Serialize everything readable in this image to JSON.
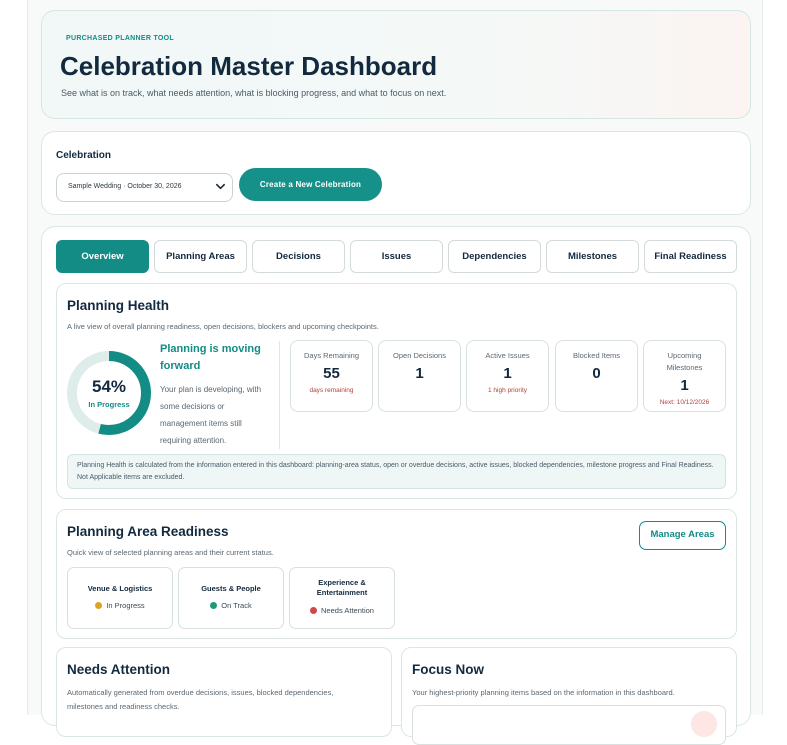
{
  "header": {
    "eyebrow": "PURCHASED PLANNER TOOL",
    "title": "Celebration Master Dashboard",
    "subtitle": "See what is on track, what needs attention, what is blocking progress, and what to focus on next."
  },
  "celebration": {
    "label": "Celebration",
    "selected": "Sample Wedding · October 30, 2026",
    "create_button": "Create a New Celebration"
  },
  "tabs": [
    {
      "label": "Overview",
      "active": true
    },
    {
      "label": "Planning Areas",
      "active": false
    },
    {
      "label": "Decisions",
      "active": false
    },
    {
      "label": "Issues",
      "active": false
    },
    {
      "label": "Dependencies",
      "active": false
    },
    {
      "label": "Milestones",
      "active": false
    },
    {
      "label": "Final Readiness",
      "active": false
    }
  ],
  "health": {
    "title": "Planning Health",
    "subtitle": "A live view of overall planning readiness, open decisions, blockers and upcoming checkpoints.",
    "percent": "54%",
    "percent_value": 0.54,
    "status": "In Progress",
    "headline": "Planning is moving forward",
    "description": "Your plan is developing, with some decisions or management items still requiring attention.",
    "stats": [
      {
        "label": "Days Remaining",
        "value": "55",
        "note": "days remaining"
      },
      {
        "label": "Open Decisions",
        "value": "1",
        "note": ""
      },
      {
        "label": "Active Issues",
        "value": "1",
        "note": "1 high priority"
      },
      {
        "label": "Blocked Items",
        "value": "0",
        "note": ""
      },
      {
        "label": "Upcoming Milestones",
        "value": "1",
        "note": "Next: 10/12/2026"
      }
    ],
    "info": "Planning Health is calculated from the information entered in this dashboard: planning-area status, open or overdue decisions, active issues, blocked dependencies, milestone progress and Final Readiness. Not Applicable items are excluded."
  },
  "areas": {
    "title": "Planning Area Readiness",
    "subtitle": "Quick view of selected planning areas and their current status.",
    "manage_button": "Manage Areas",
    "items": [
      {
        "name": "Venue & Logistics",
        "status": "In Progress",
        "color": "#e0a020"
      },
      {
        "name": "Guests & People",
        "status": "On Track",
        "color": "#1f9a78"
      },
      {
        "name": "Experience & Entertainment",
        "status": "Needs Attention",
        "color": "#d04848"
      }
    ]
  },
  "needs_attention": {
    "title": "Needs Attention",
    "subtitle": "Automatically generated from overdue decisions, issues, blocked dependencies, milestones and readiness checks."
  },
  "focus_now": {
    "title": "Focus Now",
    "subtitle": "Your highest-priority planning items based on the information in this dashboard."
  },
  "colors": {
    "accent": "#138c85",
    "warning_text": "#b0403a"
  }
}
